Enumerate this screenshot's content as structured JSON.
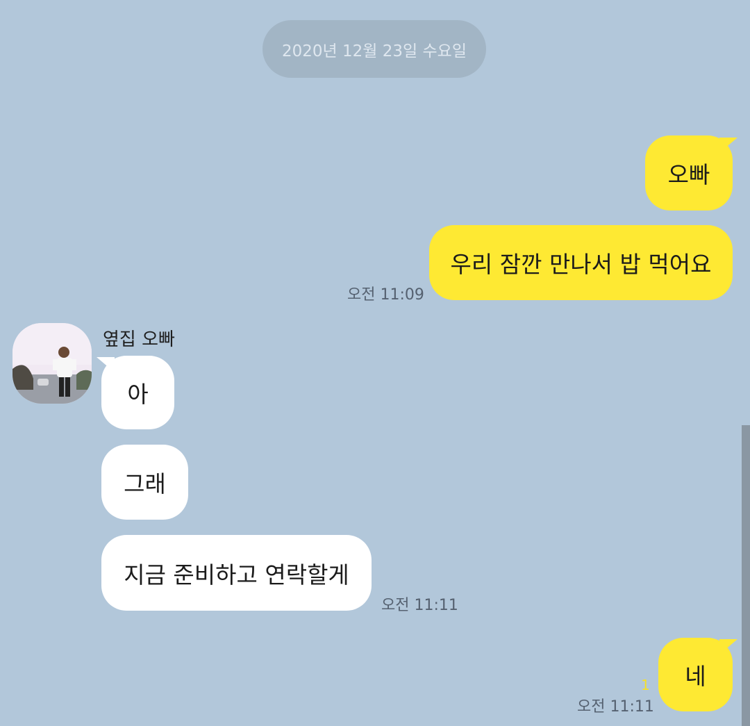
{
  "date_divider": "2020년 12월 23일 수요일",
  "messages": {
    "m1": {
      "text": "오빠"
    },
    "m2": {
      "text": "우리 잠깐 만나서 밥 먹어요",
      "time": "오전 11:09"
    },
    "m3": {
      "sender": "옆집 오빠",
      "text": "아"
    },
    "m4": {
      "text": "그래"
    },
    "m5": {
      "text": "지금 준비하고 연락할게",
      "time": "오전 11:11"
    },
    "m6": {
      "text": "네",
      "unread_count": "1",
      "time": "오전 11:11"
    }
  },
  "colors": {
    "background": "#b2c7da",
    "my_bubble": "#fee933",
    "their_bubble": "#ffffff",
    "unread": "#f5e02a"
  },
  "icons": {
    "avatar": "profile-photo"
  }
}
